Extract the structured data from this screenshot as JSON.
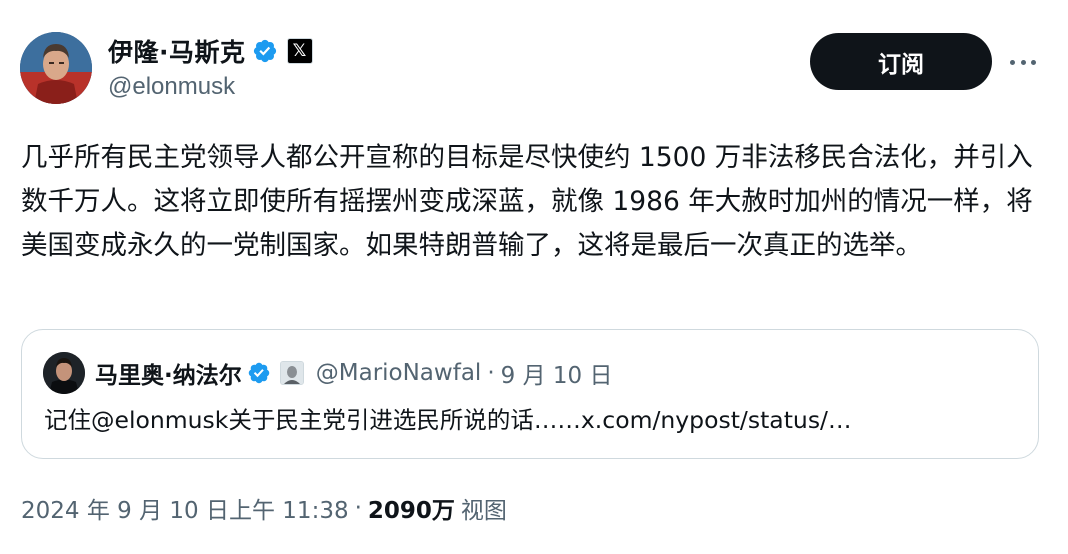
{
  "author": {
    "display_name": "伊隆·马斯克",
    "handle": "@elonmusk",
    "verified_icon": "verified-check-icon",
    "affiliate_label": "𝕏",
    "badge_color": "#1d9bf0"
  },
  "actions": {
    "subscribe_label": "订阅",
    "more_icon": "more-horizontal-icon"
  },
  "tweet": {
    "text": "几乎所有民主党领导人都公开宣称的目标是尽快使约 1500 万非法移民合法化，并引入数千万人。这将立即使所有摇摆州变成深蓝，就像 1986 年大赦时加州的情况一样，将美国变成永久的一党制国家。如果特朗普输了，这将是最后一次真正的选举。"
  },
  "quote": {
    "display_name": "马里奥·纳法尔",
    "handle": "@MarioNawfal",
    "separator": "·",
    "date": "9 月 10 日",
    "text": "记住@elonmusk关于民主党引进选民所说的话……x.com/nypost/status/…"
  },
  "meta": {
    "timestamp": "2024 年 9 月 10 日上午 11:38",
    "separator": "·",
    "views_count": "2090万",
    "views_label": "视图"
  },
  "colors": {
    "text_primary": "#0f1419",
    "text_secondary": "#536471",
    "border": "#cfd9de",
    "button_bg": "#0f1419"
  }
}
